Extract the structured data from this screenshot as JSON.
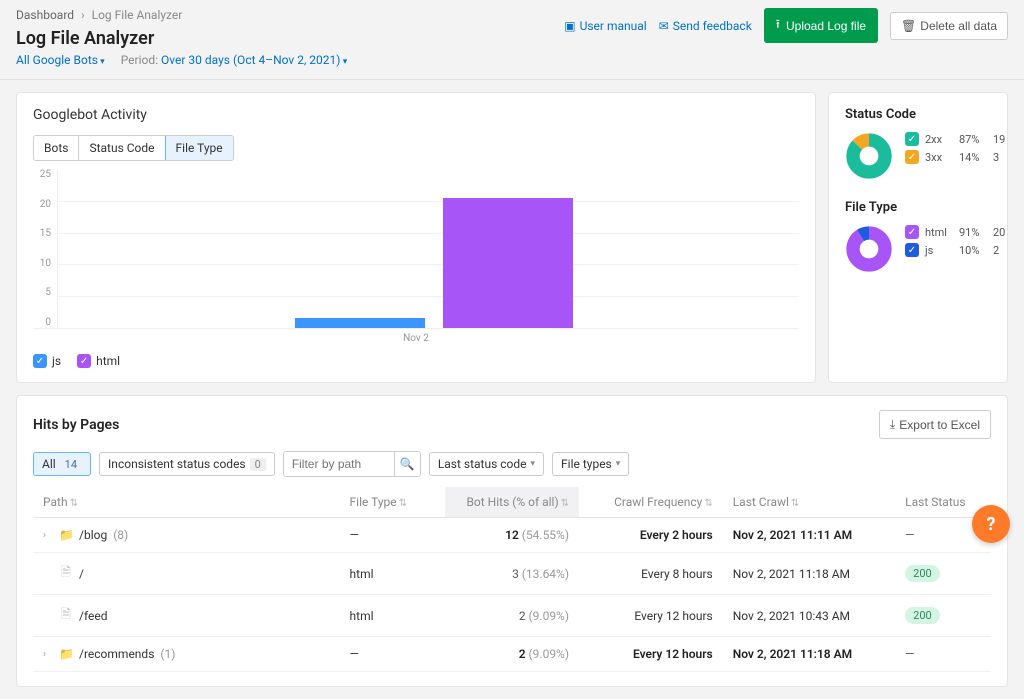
{
  "breadcrumb": {
    "root": "Dashboard",
    "current": "Log File Analyzer"
  },
  "page_title": "Log File Analyzer",
  "filters": {
    "bots": "All Google Bots",
    "period_label": "Period:",
    "period_value": "Over 30 days (Oct 4–Nov 2, 2021)"
  },
  "header_links": {
    "manual": "User manual",
    "feedback": "Send feedback",
    "upload": "Upload Log file",
    "delete": "Delete all data"
  },
  "activity": {
    "title": "Googlebot Activity",
    "tabs": [
      "Bots",
      "Status Code",
      "File Type"
    ],
    "active_tab": 2,
    "y_ticks": [
      "25",
      "20",
      "15",
      "10",
      "5",
      "0"
    ],
    "x_label": "Nov 2",
    "legend": {
      "js": "js",
      "html": "html"
    }
  },
  "chart_data": {
    "type": "bar",
    "categories": [
      "Nov 2"
    ],
    "series": [
      {
        "name": "js",
        "values": [
          2
        ]
      },
      {
        "name": "html",
        "values": [
          20
        ]
      }
    ],
    "ylim": [
      0,
      25
    ],
    "xlabel": "",
    "ylabel": ""
  },
  "status_code": {
    "title": "Status Code",
    "items": [
      {
        "label": "2xx",
        "pct": "87%",
        "count": "19",
        "color": "green"
      },
      {
        "label": "3xx",
        "pct": "14%",
        "count": "3",
        "color": "orange"
      }
    ]
  },
  "file_type": {
    "title": "File Type",
    "items": [
      {
        "label": "html",
        "pct": "91%",
        "count": "20",
        "color": "purple"
      },
      {
        "label": "js",
        "pct": "10%",
        "count": "2",
        "color": "darkblue"
      }
    ]
  },
  "hits": {
    "title": "Hits by Pages",
    "export": "Export to Excel",
    "filters": {
      "all_label": "All",
      "all_count": "14",
      "inconsistent_label": "Inconsistent status codes",
      "inconsistent_count": "0",
      "search_placeholder": "Filter by path",
      "last_status": "Last status code",
      "file_types": "File types"
    },
    "columns": {
      "path": "Path",
      "file_type": "File Type",
      "bot_hits": "Bot Hits (% of all)",
      "crawl_freq": "Crawl Frequency",
      "last_crawl": "Last Crawl",
      "last_status": "Last Status"
    },
    "rows": [
      {
        "expandable": true,
        "icon": "folder",
        "path": "/blog",
        "path_suffix": "(8)",
        "file_type": "—",
        "hits_bold": "12",
        "hits_rest": "(54.55%)",
        "freq": "Every 2 hours",
        "freq_bold": true,
        "crawl": "Nov 2, 2021 11:11 AM",
        "crawl_bold": true,
        "status": "—"
      },
      {
        "expandable": false,
        "icon": "file",
        "path": "/",
        "file_type": "html",
        "hits_bold": "3",
        "hits_rest": "(13.64%)",
        "freq": "Every 8 hours",
        "crawl": "Nov 2, 2021 11:18 AM",
        "status": "200"
      },
      {
        "expandable": false,
        "icon": "file",
        "path": "/feed",
        "file_type": "html",
        "hits_bold": "2",
        "hits_rest": "(9.09%)",
        "freq": "Every 12 hours",
        "crawl": "Nov 2, 2021 10:43 AM",
        "status": "200"
      },
      {
        "expandable": true,
        "icon": "folder",
        "path": "/recommends",
        "path_suffix": "(1)",
        "file_type": "—",
        "hits_bold": "2",
        "hits_rest": "(9.09%)",
        "freq": "Every 12 hours",
        "freq_bold": true,
        "crawl": "Nov 2, 2021 11:18 AM",
        "crawl_bold": true,
        "status": "—"
      }
    ]
  },
  "fab": "?"
}
